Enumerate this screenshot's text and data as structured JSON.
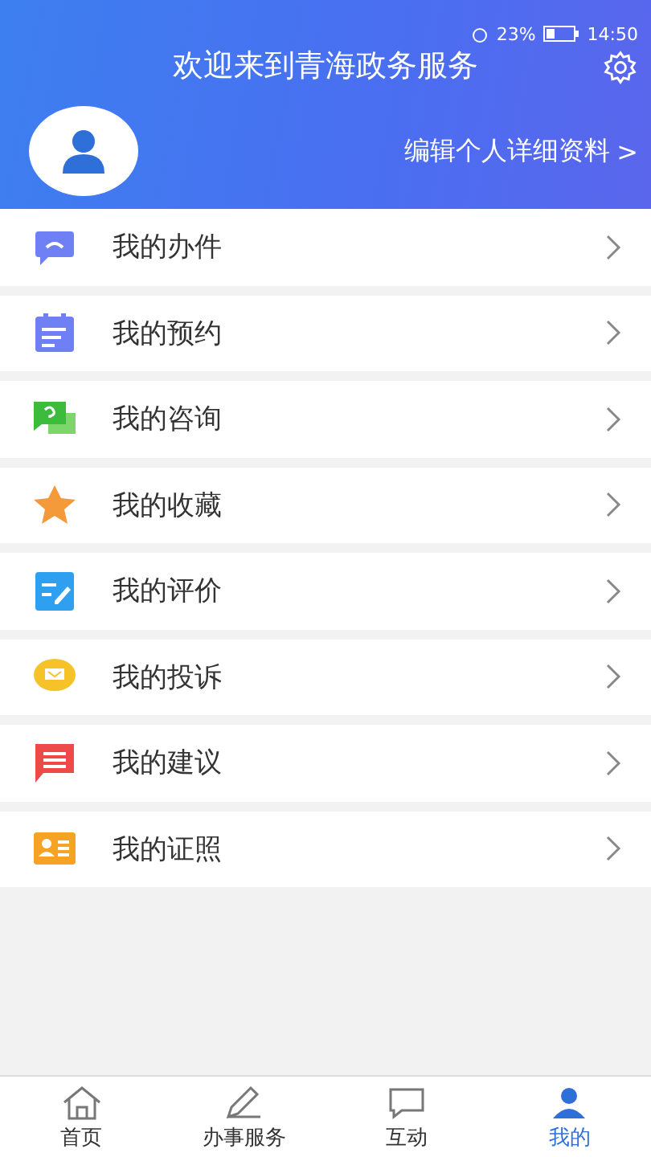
{
  "status_bar": {
    "battery": "23%",
    "time": "14:50"
  },
  "header": {
    "title": "欢迎来到青海政务服务",
    "profile_link": "编辑个人详细资料",
    "chevron": ">"
  },
  "menu": [
    {
      "label": "我的办件"
    },
    {
      "label": "我的预约"
    },
    {
      "label": "我的咨询"
    },
    {
      "label": "我的收藏"
    },
    {
      "label": "我的评价"
    },
    {
      "label": "我的投诉"
    },
    {
      "label": "我的建议"
    },
    {
      "label": "我的证照"
    }
  ],
  "tab_bar": [
    {
      "label": "首页",
      "selected": false
    },
    {
      "label": "办事服务",
      "selected": false
    },
    {
      "label": "互动",
      "selected": false
    },
    {
      "label": "我的",
      "selected": true
    }
  ]
}
